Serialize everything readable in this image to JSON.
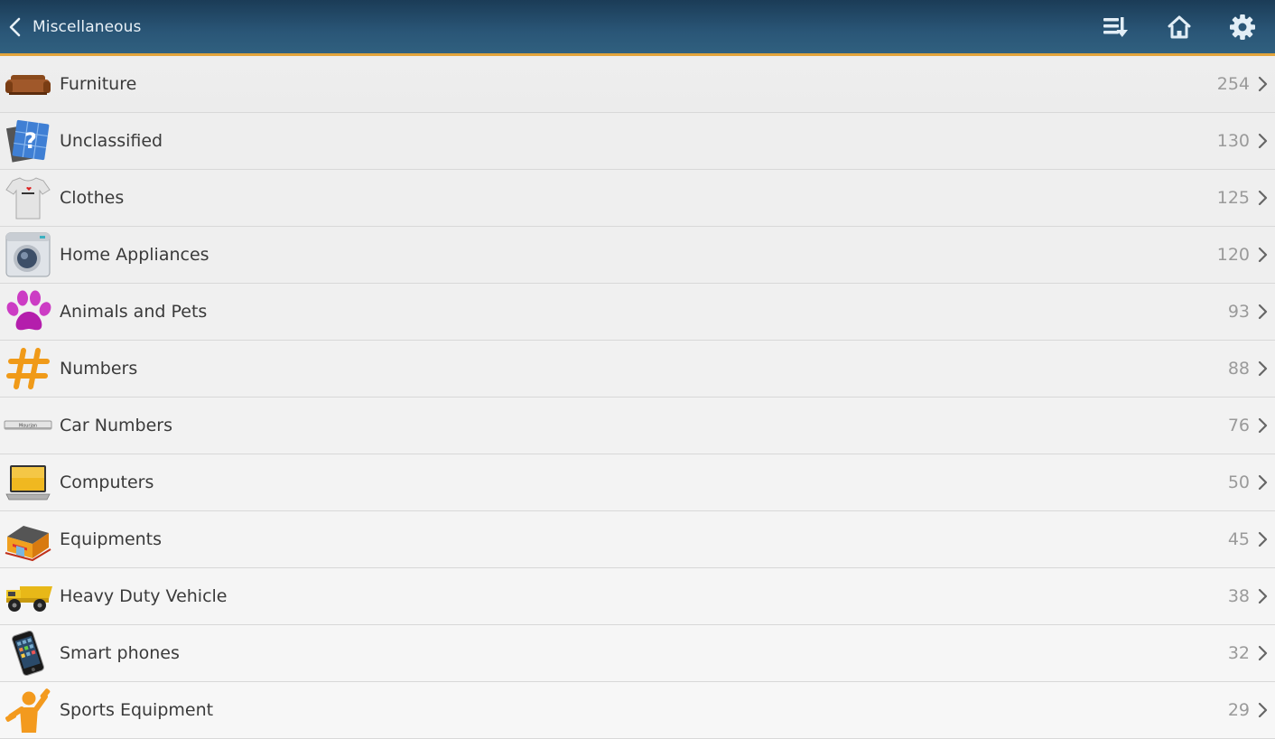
{
  "header": {
    "title": "Miscellaneous",
    "back_icon": "chevron-left-icon",
    "actions": [
      {
        "name": "sort-icon",
        "label": "Sort"
      },
      {
        "name": "home-icon",
        "label": "Home"
      },
      {
        "name": "gear-icon",
        "label": "Settings"
      }
    ]
  },
  "theme": {
    "header_color": "#2a5677",
    "accent": "#e3a43b",
    "count_color": "#9a9a9a"
  },
  "items": [
    {
      "label": "Furniture",
      "count": "254",
      "icon": "sofa-icon"
    },
    {
      "label": "Unclassified",
      "count": "130",
      "icon": "question-tile-icon"
    },
    {
      "label": "Clothes",
      "count": "125",
      "icon": "tshirt-icon"
    },
    {
      "label": "Home Appliances",
      "count": "120",
      "icon": "washing-machine-icon"
    },
    {
      "label": "Animals and Pets",
      "count": "93",
      "icon": "paw-icon"
    },
    {
      "label": "Numbers",
      "count": "88",
      "icon": "hash-icon"
    },
    {
      "label": "Car Numbers",
      "count": "76",
      "icon": "license-plate-icon",
      "icon_text": "Mourjan"
    },
    {
      "label": "Computers",
      "count": "50",
      "icon": "laptop-icon"
    },
    {
      "label": "Equipments",
      "count": "45",
      "icon": "shop-icon"
    },
    {
      "label": "Heavy Duty Vehicle",
      "count": "38",
      "icon": "dump-truck-icon"
    },
    {
      "label": "Smart phones",
      "count": "32",
      "icon": "smartphone-icon"
    },
    {
      "label": "Sports Equipment",
      "count": "29",
      "icon": "weightlifter-icon"
    }
  ]
}
